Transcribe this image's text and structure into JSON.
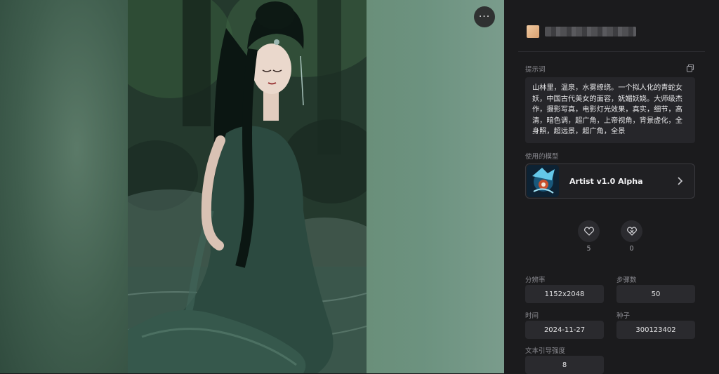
{
  "viewer": {
    "more_label": "···"
  },
  "panel": {
    "prompt_section_label": "提示词",
    "prompt_text": "山林里，温泉，水雾缭绕。一个拟人化的青蛇女妖，中国古代美女的面容，妩媚妖娆。大师级杰作，摄影写真，电影灯光效果，真实，细节，高清，暗色调，超广角，上帝视角，背景虚化，全身照，超远景，超广角，全景",
    "model_section_label": "使用的模型",
    "model_name": "Artist v1.0 Alpha",
    "like_count": "5",
    "dislike_count": "0",
    "resolution_label": "分辨率",
    "resolution_value": "1152x2048",
    "steps_label": "步骤数",
    "steps_value": "50",
    "time_label": "时间",
    "time_value": "2024-11-27",
    "seed_label": "种子",
    "seed_value": "300123402",
    "guidance_label": "文本引导强度",
    "guidance_value": "8"
  },
  "colors": {
    "panel_bg": "#1b1b1d",
    "box_bg": "#2a2a2e",
    "accent_text": "#f2f2f4"
  }
}
